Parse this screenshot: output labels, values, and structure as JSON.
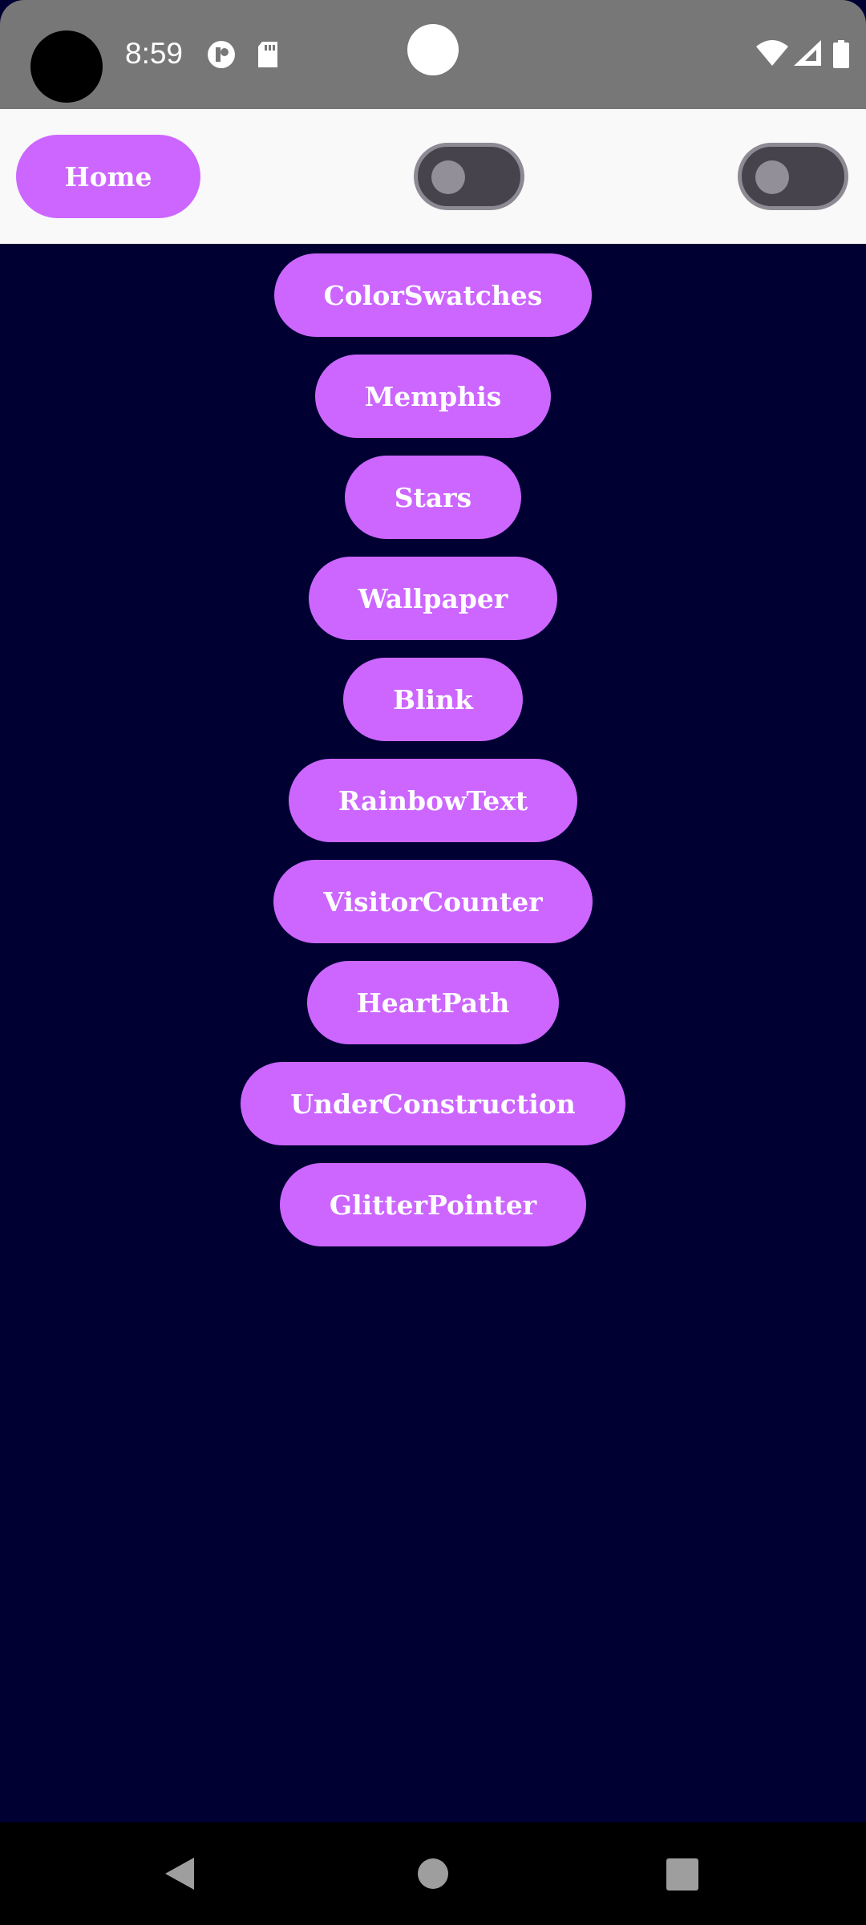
{
  "status_bar": {
    "time": "8:59",
    "icons": [
      "app-notification-icon",
      "sd-card-icon",
      "wifi-icon",
      "cell-signal-icon",
      "battery-icon"
    ]
  },
  "header": {
    "home_label": "Home",
    "toggles": [
      {
        "name": "toggle-1",
        "state": "off"
      },
      {
        "name": "toggle-2",
        "state": "off"
      }
    ]
  },
  "menu": {
    "items": [
      {
        "label": "ColorSwatches"
      },
      {
        "label": "Memphis"
      },
      {
        "label": "Stars"
      },
      {
        "label": "Wallpaper"
      },
      {
        "label": "Blink"
      },
      {
        "label": "RainbowText"
      },
      {
        "label": "VisitorCounter"
      },
      {
        "label": "HeartPath"
      },
      {
        "label": "UnderConstruction"
      },
      {
        "label": "GlitterPointer"
      }
    ]
  },
  "nav_bar": {
    "icons": [
      "back-icon",
      "home-icon",
      "recents-icon"
    ]
  },
  "colors": {
    "accent": "#cc66ff",
    "background": "#000033",
    "header_background": "#f9f9f9",
    "status_bar": "#777777"
  }
}
